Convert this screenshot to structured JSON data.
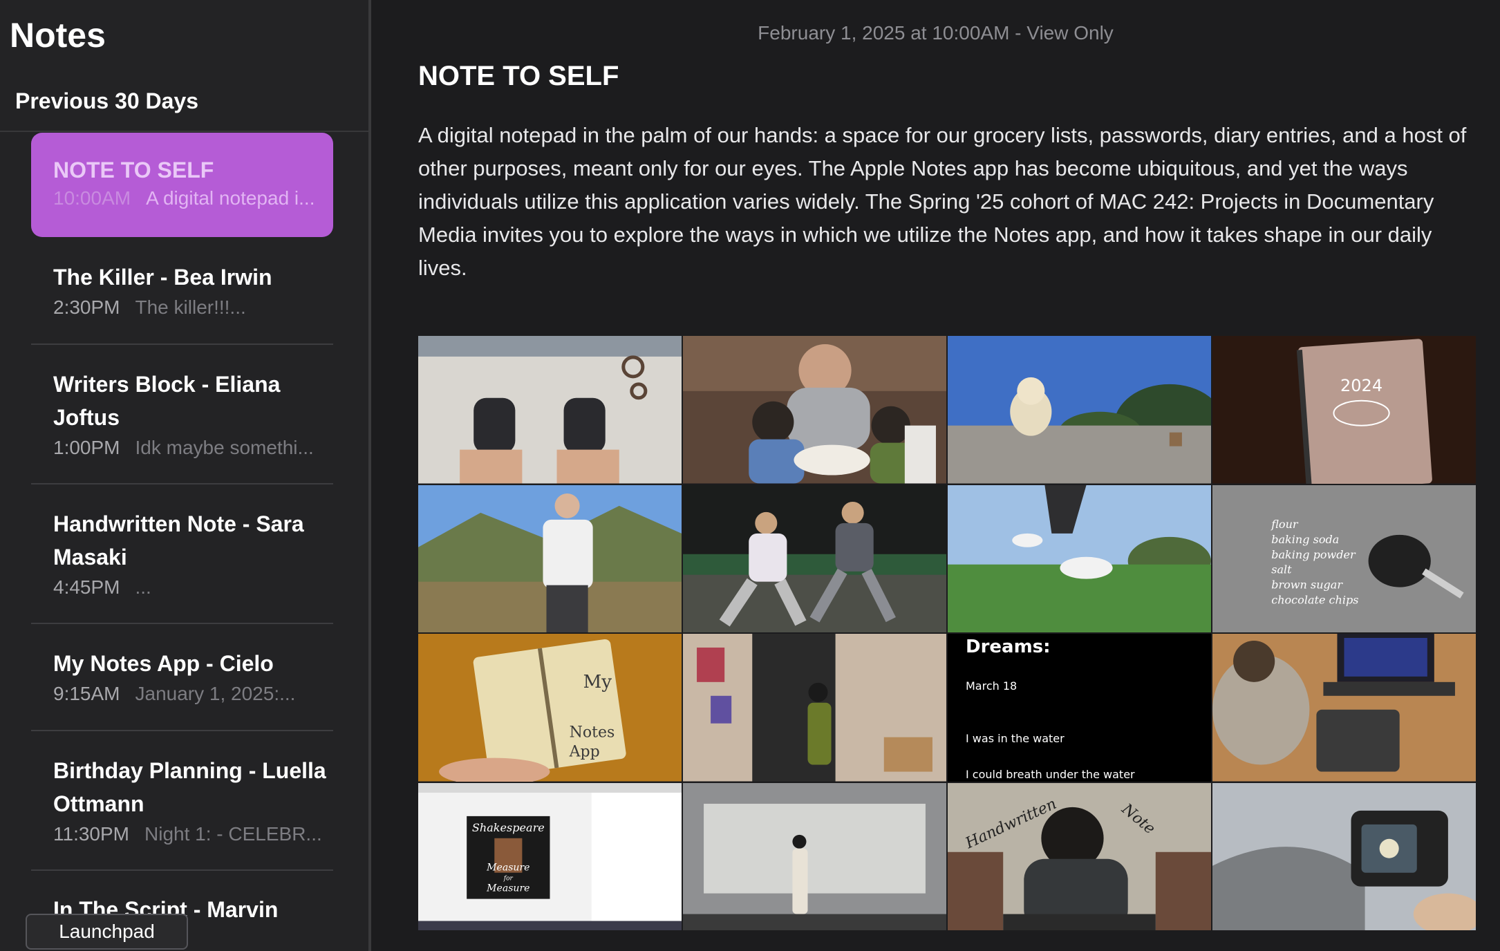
{
  "sidebar": {
    "app_title": "Notes",
    "section": "Previous 30 Days",
    "notes": [
      {
        "title": "NOTE TO SELF",
        "time": "10:00AM",
        "preview": "A digital notepad i..."
      },
      {
        "title": "The Killer - Bea Irwin",
        "time": "2:30PM",
        "preview": "The killer!!!..."
      },
      {
        "title": "Writers Block - Eliana Joftus",
        "time": "1:00PM",
        "preview": "Idk maybe somethi..."
      },
      {
        "title": "Handwritten Note - Sara Masaki",
        "time": "4:45PM",
        "preview": "..."
      },
      {
        "title": "My Notes App - Cielo",
        "time": "9:15AM",
        "preview": "January 1, 2025:..."
      },
      {
        "title": "Birthday Planning - Luella Ottmann",
        "time": "11:30PM",
        "preview": "Night 1: - CELEBR..."
      },
      {
        "title": "In The Script - Marvin",
        "time": "",
        "preview": ""
      }
    ]
  },
  "dock": {
    "launchpad_label": "Launchpad"
  },
  "note": {
    "header": "February 1, 2025 at 10:00AM - View Only",
    "title": "NOTE TO SELF",
    "body": "A digital notepad in the palm of our hands: a space for our grocery lists, passwords, diary entries, and a host of other purposes, meant only for our eyes. The Apple Notes app has become ubiquitous, and yet the ways individuals utilize this application varies widely. The Spring '25 cohort of MAC 242: Projects in Documentary Media invites you to explore the ways in which we utilize the Notes app, and how it takes shape in our daily lives."
  },
  "gallery": {
    "notebook_year": "2024",
    "recipe_lines": [
      "flour",
      "baking soda",
      "baking powder",
      "salt",
      "brown sugar",
      "chocolate chips"
    ],
    "sketch_text": [
      "My",
      "Notes",
      "App"
    ],
    "dream_heading": "Dreams:",
    "dream_lines": [
      "March 18",
      "I was in the water",
      "I could breath under the water"
    ],
    "book_title": [
      "Shakespeare",
      "Measure",
      "for",
      "Measure"
    ],
    "handwritten_text": [
      "Handwritten",
      "Note"
    ]
  },
  "colors": {
    "accent": "#b55cd6",
    "background": "#1c1c1e",
    "sidebar": "#232325"
  }
}
